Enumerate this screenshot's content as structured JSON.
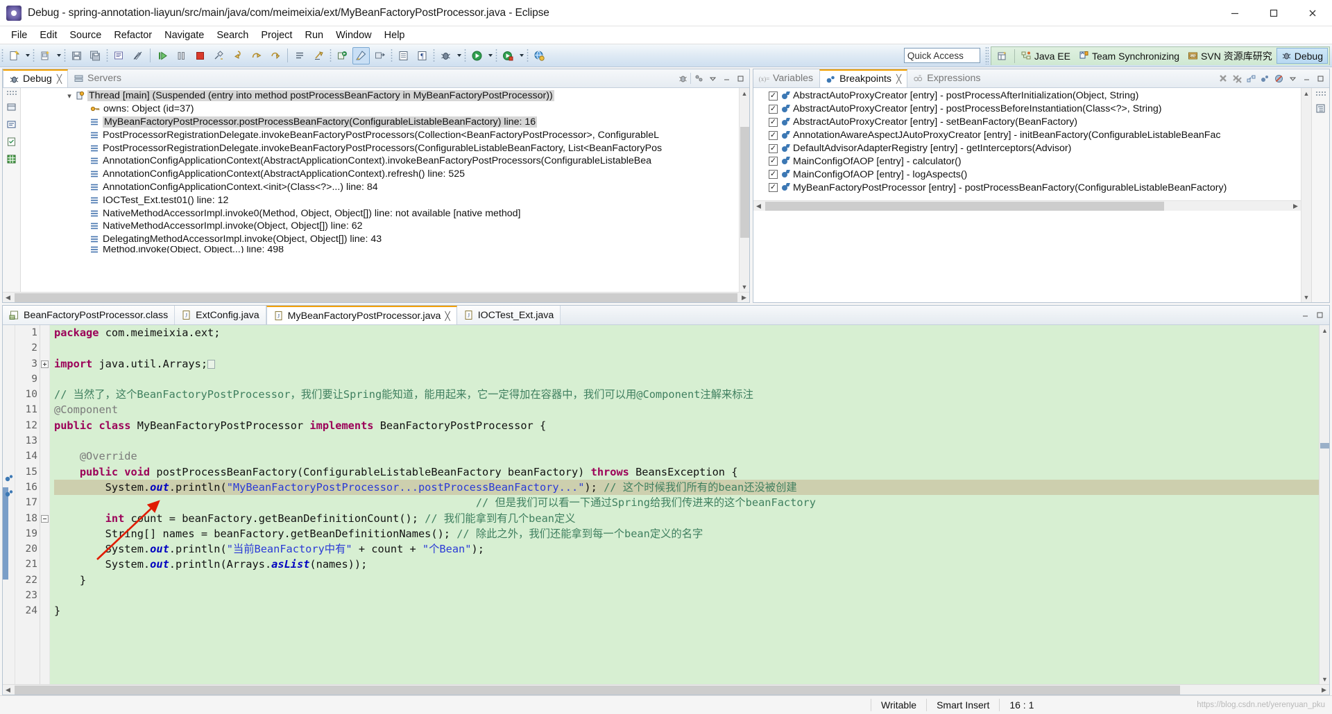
{
  "window": {
    "title": "Debug - spring-annotation-liayun/src/main/java/com/meimeixia/ext/MyBeanFactoryPostProcessor.java - Eclipse",
    "minimize_label": "Minimize",
    "maximize_label": "Restore",
    "close_label": "Close"
  },
  "menubar": {
    "items": [
      "File",
      "Edit",
      "Source",
      "Refactor",
      "Navigate",
      "Search",
      "Project",
      "Run",
      "Window",
      "Help"
    ]
  },
  "toolbar": {
    "quick_access_placeholder": "Quick Access",
    "perspectives": [
      {
        "label": "Java EE",
        "active": false
      },
      {
        "label": "Team Synchronizing",
        "active": false
      },
      {
        "label": "SVN 资源库研究",
        "active": false
      },
      {
        "label": "Debug",
        "active": true
      }
    ]
  },
  "debug_view": {
    "tabs": [
      {
        "label": "Debug",
        "active": true,
        "closable": true
      },
      {
        "label": "Servers",
        "active": false,
        "closable": false
      }
    ],
    "thread_node": "Thread [main] (Suspended (entry into method postProcessBeanFactory in MyBeanFactoryPostProcessor))",
    "owns_node": "owns: Object  (id=37)",
    "stack_frames": [
      {
        "text": "MyBeanFactoryPostProcessor.postProcessBeanFactory(ConfigurableListableBeanFactory) line: 16",
        "selected": true
      },
      {
        "text": "PostProcessorRegistrationDelegate.invokeBeanFactoryPostProcessors(Collection<BeanFactoryPostProcessor>, ConfigurableL",
        "selected": false
      },
      {
        "text": "PostProcessorRegistrationDelegate.invokeBeanFactoryPostProcessors(ConfigurableListableBeanFactory, List<BeanFactoryPos",
        "selected": false
      },
      {
        "text": "AnnotationConfigApplicationContext(AbstractApplicationContext).invokeBeanFactoryPostProcessors(ConfigurableListableBea",
        "selected": false
      },
      {
        "text": "AnnotationConfigApplicationContext(AbstractApplicationContext).refresh() line: 525",
        "selected": false
      },
      {
        "text": "AnnotationConfigApplicationContext.<init>(Class<?>...) line: 84",
        "selected": false
      },
      {
        "text": "IOCTest_Ext.test01() line: 12",
        "selected": false
      },
      {
        "text": "NativeMethodAccessorImpl.invoke0(Method, Object, Object[]) line: not available [native method]",
        "selected": false
      },
      {
        "text": "NativeMethodAccessorImpl.invoke(Object, Object[]) line: 62",
        "selected": false
      },
      {
        "text": "DelegatingMethodAccessorImpl.invoke(Object, Object[]) line: 43",
        "selected": false
      },
      {
        "text": "Method.invoke(Object, Object...) line: 498",
        "selected": false
      }
    ]
  },
  "breakpoints_view": {
    "tabs": [
      {
        "label": "Variables",
        "active": false,
        "closable": false
      },
      {
        "label": "Breakpoints",
        "active": true,
        "closable": true
      },
      {
        "label": "Expressions",
        "active": false,
        "closable": false
      }
    ],
    "items": [
      {
        "checked": true,
        "label": "AbstractAutoProxyCreator [entry] - postProcessAfterInitialization(Object, String)"
      },
      {
        "checked": true,
        "label": "AbstractAutoProxyCreator [entry] - postProcessBeforeInstantiation(Class<?>, String)"
      },
      {
        "checked": true,
        "label": "AbstractAutoProxyCreator [entry] - setBeanFactory(BeanFactory)"
      },
      {
        "checked": true,
        "label": "AnnotationAwareAspectJAutoProxyCreator [entry] - initBeanFactory(ConfigurableListableBeanFac"
      },
      {
        "checked": true,
        "label": "DefaultAdvisorAdapterRegistry [entry] - getInterceptors(Advisor)"
      },
      {
        "checked": true,
        "label": "MainConfigOfAOP [entry] - calculator()"
      },
      {
        "checked": true,
        "label": "MainConfigOfAOP [entry] - logAspects()"
      },
      {
        "checked": true,
        "label": "MyBeanFactoryPostProcessor [entry] - postProcessBeanFactory(ConfigurableListableBeanFactory)"
      }
    ]
  },
  "editor": {
    "tabs": [
      {
        "label": "BeanFactoryPostProcessor.class",
        "active": false,
        "closable": false,
        "icon": "class-file-icon"
      },
      {
        "label": "ExtConfig.java",
        "active": false,
        "closable": false,
        "icon": "java-file-icon"
      },
      {
        "label": "MyBeanFactoryPostProcessor.java",
        "active": true,
        "closable": true,
        "icon": "java-file-icon"
      },
      {
        "label": "IOCTest_Ext.java",
        "active": false,
        "closable": false,
        "icon": "java-file-icon"
      }
    ],
    "lines": [
      {
        "no": "1",
        "marker": "",
        "fold": "",
        "current": false,
        "segments": [
          {
            "t": "package ",
            "c": "kw"
          },
          {
            "t": "com.meimeixia.ext;",
            "c": "plain"
          }
        ]
      },
      {
        "no": "2",
        "marker": "",
        "fold": "",
        "current": false,
        "segments": []
      },
      {
        "no": "3",
        "marker": "",
        "fold": "plus",
        "current": false,
        "segments": [
          {
            "t": "import ",
            "c": "kw"
          },
          {
            "t": "java.util.Arrays;",
            "c": "plain"
          },
          {
            "t": "□",
            "c": "impbox"
          }
        ]
      },
      {
        "no": "9",
        "marker": "",
        "fold": "",
        "current": false,
        "segments": []
      },
      {
        "no": "10",
        "marker": "",
        "fold": "",
        "current": false,
        "segments": [
          {
            "t": "// 当然了，这个BeanFactoryPostProcessor，我们要让Spring能知道，能用起来，它一定得加在容器中，我们可以用@Component注解来标注",
            "c": "cmt"
          }
        ]
      },
      {
        "no": "11",
        "marker": "",
        "fold": "",
        "current": false,
        "segments": [
          {
            "t": "@Component",
            "c": "ann"
          }
        ]
      },
      {
        "no": "12",
        "marker": "",
        "fold": "",
        "current": false,
        "segments": [
          {
            "t": "public class ",
            "c": "kw"
          },
          {
            "t": "MyBeanFactoryPostProcessor ",
            "c": "plain"
          },
          {
            "t": "implements ",
            "c": "kw"
          },
          {
            "t": "BeanFactoryPostProcessor {",
            "c": "plain"
          }
        ]
      },
      {
        "no": "13",
        "marker": "",
        "fold": "",
        "current": false,
        "segments": []
      },
      {
        "no": "14",
        "marker": "",
        "fold": "minus",
        "current": false,
        "segments": [
          {
            "t": "    @Override",
            "c": "ann"
          }
        ]
      },
      {
        "no": "15",
        "marker": "bp",
        "fold": "",
        "current": false,
        "segments": [
          {
            "t": "    public void ",
            "c": "kw"
          },
          {
            "t": "postProcessBeanFactory(ConfigurableListableBeanFactory beanFactory) ",
            "c": "plain"
          },
          {
            "t": "throws ",
            "c": "kw"
          },
          {
            "t": "BeansException {",
            "c": "plain"
          }
        ]
      },
      {
        "no": "16",
        "marker": "bparrow",
        "fold": "",
        "current": true,
        "segments": [
          {
            "t": "        System.",
            "c": "plain"
          },
          {
            "t": "out",
            "c": "fld"
          },
          {
            "t": ".println(",
            "c": "plain"
          },
          {
            "t": "\"MyBeanFactoryPostProcessor...postProcessBeanFactory...\"",
            "c": "str"
          },
          {
            "t": "); ",
            "c": "plain"
          },
          {
            "t": "// 这个时候我们所有的bean还没被创建",
            "c": "cmt"
          }
        ]
      },
      {
        "no": "17",
        "marker": "",
        "fold": "",
        "current": false,
        "segments": [
          {
            "t": "                                                                  // 但是我们可以看一下通过Spring给我们传进来的这个beanFactory",
            "c": "cmt"
          }
        ]
      },
      {
        "no": "18",
        "marker": "",
        "fold": "",
        "current": false,
        "segments": [
          {
            "t": "        ",
            "c": "plain"
          },
          {
            "t": "int ",
            "c": "kw"
          },
          {
            "t": "count = beanFactory.getBeanDefinitionCount(); ",
            "c": "plain"
          },
          {
            "t": "// 我们能拿到有几个bean定义",
            "c": "cmt"
          }
        ]
      },
      {
        "no": "19",
        "marker": "",
        "fold": "",
        "current": false,
        "segments": [
          {
            "t": "        String[] names = beanFactory.getBeanDefinitionNames(); ",
            "c": "plain"
          },
          {
            "t": "// 除此之外，我们还能拿到每一个bean定义的名字",
            "c": "cmt"
          }
        ]
      },
      {
        "no": "20",
        "marker": "",
        "fold": "",
        "current": false,
        "segments": [
          {
            "t": "        System.",
            "c": "plain"
          },
          {
            "t": "out",
            "c": "fld"
          },
          {
            "t": ".println(",
            "c": "plain"
          },
          {
            "t": "\"当前BeanFactory中有\"",
            "c": "str"
          },
          {
            "t": " + count + ",
            "c": "plain"
          },
          {
            "t": "\"个Bean\"",
            "c": "str"
          },
          {
            "t": ");",
            "c": "plain"
          }
        ]
      },
      {
        "no": "21",
        "marker": "",
        "fold": "",
        "current": false,
        "segments": [
          {
            "t": "        System.",
            "c": "plain"
          },
          {
            "t": "out",
            "c": "fld"
          },
          {
            "t": ".println(Arrays.",
            "c": "plain"
          },
          {
            "t": "asList",
            "c": "fld"
          },
          {
            "t": "(names));",
            "c": "plain"
          }
        ]
      },
      {
        "no": "22",
        "marker": "",
        "fold": "",
        "current": false,
        "segments": [
          {
            "t": "    }",
            "c": "plain"
          }
        ]
      },
      {
        "no": "23",
        "marker": "",
        "fold": "",
        "current": false,
        "segments": []
      },
      {
        "no": "24",
        "marker": "",
        "fold": "",
        "current": false,
        "segments": [
          {
            "t": "}",
            "c": "plain"
          }
        ]
      }
    ]
  },
  "statusbar": {
    "writable": "Writable",
    "insert_mode": "Smart Insert",
    "position": "16 : 1",
    "watermark": "https://blog.csdn.net/yerenyuan_pku"
  },
  "colors": {
    "editor_background": "#d7efd2",
    "current_line": "#cdcfae",
    "selection": "#d6d6d6",
    "keyword": "#9b0058",
    "string": "#2a3ad6",
    "comment": "#3f7f5f",
    "accent_tab": "#f2a000",
    "arrow": "#e01b00"
  }
}
